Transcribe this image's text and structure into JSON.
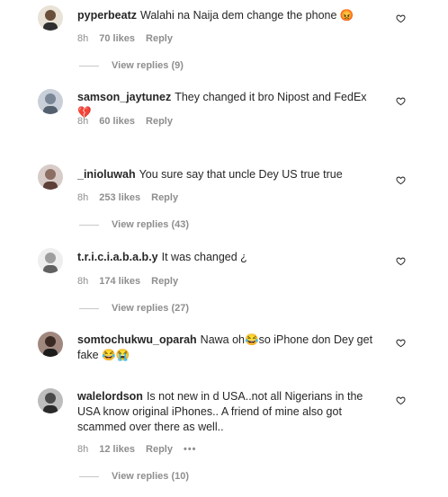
{
  "comments": [
    {
      "username": "pyperbeatz",
      "text": "Walahi na Naija dem change the phone 😡",
      "time": "8h",
      "likes": "70 likes",
      "reply": "Reply",
      "view_replies": "View replies (9)",
      "avatar_color": "#6b4f3a"
    },
    {
      "username": "samson_jaytunez",
      "text": "They changed it bro Nipost and FedEx 💔",
      "time": "8h",
      "likes": "60 likes",
      "reply": "Reply",
      "avatar_color": "#7a8596"
    },
    {
      "username": "_inioluwah",
      "text": "You sure say that uncle Dey US true true",
      "time": "8h",
      "likes": "253 likes",
      "reply": "Reply",
      "view_replies": "View replies (43)",
      "avatar_color": "#8d6e63"
    },
    {
      "username": "t.r.i.c.i.a.b.a.b.y",
      "text": "It was changed ¿",
      "time": "8h",
      "likes": "174 likes",
      "reply": "Reply",
      "view_replies": "View replies (27)",
      "avatar_color": "#9e9e9e"
    },
    {
      "username": "somtochukwu_oparah",
      "text": "Nawa oh😂so iPhone don Dey get fake 😂😭",
      "time": "",
      "likes": "",
      "reply": "",
      "avatar_color": "#3b2a24"
    },
    {
      "username": "walelordson",
      "text": "Is not new in d USA..not all Nigerians in the USA know original iPhones.. A friend of mine also got scammed over there as well..",
      "time": "8h",
      "likes": "12 likes",
      "reply": "Reply",
      "more": "•••",
      "view_replies": "View replies (10)",
      "avatar_color": "#4a4a4a"
    }
  ],
  "colors": {
    "text": "#262626",
    "secondary": "#8e8e8e",
    "divider": "#c7c7c7"
  },
  "icons": {
    "like": "heart-outline-icon",
    "more": "more-options-icon"
  }
}
